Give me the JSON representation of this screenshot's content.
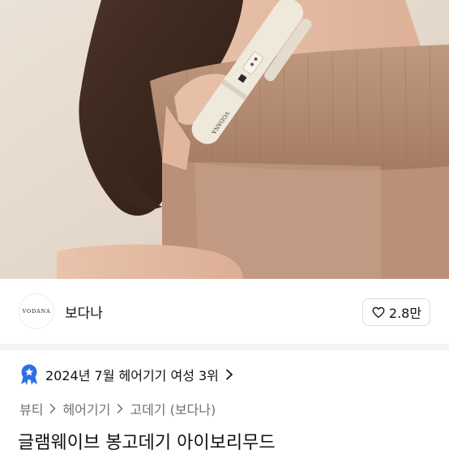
{
  "brand": {
    "logo_text": "VODANA",
    "name": "보다나"
  },
  "like": {
    "count": "2.8만"
  },
  "ranking": {
    "text": "2024년 7월 헤어기기 여성 3위"
  },
  "breadcrumb": [
    "뷰티",
    "헤어기기",
    "고데기 (보다나)"
  ],
  "product": {
    "title": "글램웨이브 봉고데기 아이보리무드"
  },
  "hero": {
    "device_text": "VODANA"
  },
  "colors": {
    "badge": "#2f6fe4",
    "photo_background": "#e6d9cc",
    "sweater": "#b68b72",
    "device": "#efe9dc"
  }
}
